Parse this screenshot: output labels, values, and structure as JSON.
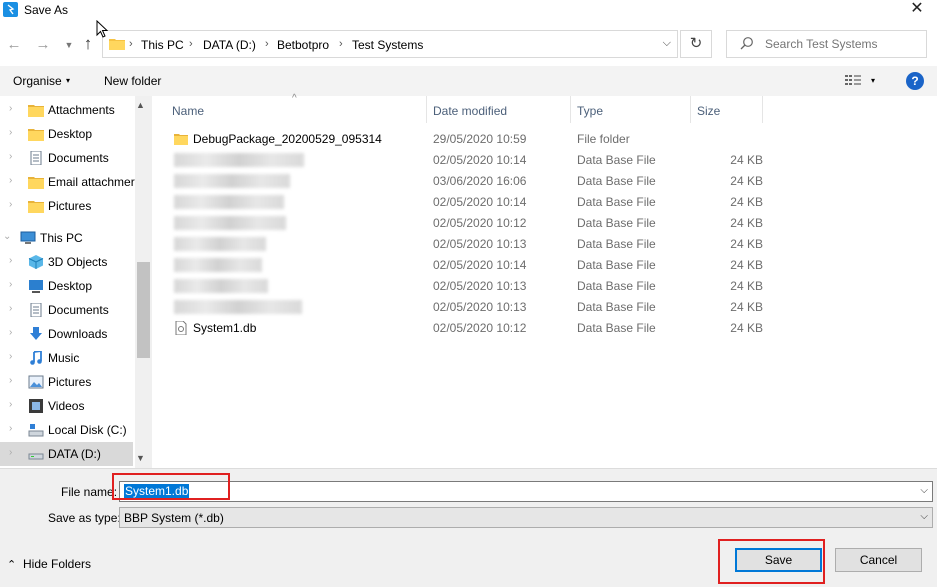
{
  "window": {
    "title": "Save As",
    "close_glyph": "✕"
  },
  "nav": {
    "back_glyph": "←",
    "forward_glyph": "→",
    "recent_glyph": "⌄",
    "up_glyph": "↑",
    "breadcrumbs": [
      "This PC",
      "DATA (D:)",
      "Betbotpro",
      "Test Systems"
    ],
    "separator": "›",
    "refresh_glyph": "↻",
    "search_placeholder": "Search Test Systems"
  },
  "toolbar": {
    "organise": "Organise",
    "new_folder": "New folder",
    "caret": "▾",
    "help": "?"
  },
  "sidebar": {
    "items": [
      {
        "label": "Attachments",
        "icon": "folder-icon"
      },
      {
        "label": "Desktop",
        "icon": "folder-icon"
      },
      {
        "label": "Documents",
        "icon": "documents-icon"
      },
      {
        "label": "Email attachmer",
        "icon": "folder-icon"
      },
      {
        "label": "Pictures",
        "icon": "folder-icon"
      },
      {
        "label": "This PC",
        "icon": "pc-icon"
      },
      {
        "label": "3D Objects",
        "icon": "cube-icon"
      },
      {
        "label": "Desktop",
        "icon": "desktop-icon"
      },
      {
        "label": "Documents",
        "icon": "documents-icon"
      },
      {
        "label": "Downloads",
        "icon": "download-icon"
      },
      {
        "label": "Music",
        "icon": "music-icon"
      },
      {
        "label": "Pictures",
        "icon": "pictures-icon"
      },
      {
        "label": "Videos",
        "icon": "videos-icon"
      },
      {
        "label": "Local Disk (C:)",
        "icon": "disk-icon"
      },
      {
        "label": "DATA (D:)",
        "icon": "drive-icon"
      }
    ]
  },
  "columns": {
    "name": "Name",
    "date": "Date modified",
    "type": "Type",
    "size": "Size"
  },
  "files": [
    {
      "name": "DebugPackage_20200529_095314",
      "date": "29/05/2020 10:59",
      "type": "File folder",
      "size": ""
    },
    {
      "name": "",
      "date": "02/05/2020 10:14",
      "type": "Data Base File",
      "size": "24 KB"
    },
    {
      "name": "",
      "date": "03/06/2020 16:06",
      "type": "Data Base File",
      "size": "24 KB"
    },
    {
      "name": "",
      "date": "02/05/2020 10:14",
      "type": "Data Base File",
      "size": "24 KB"
    },
    {
      "name": "",
      "date": "02/05/2020 10:12",
      "type": "Data Base File",
      "size": "24 KB"
    },
    {
      "name": "",
      "date": "02/05/2020 10:13",
      "type": "Data Base File",
      "size": "24 KB"
    },
    {
      "name": "",
      "date": "02/05/2020 10:14",
      "type": "Data Base File",
      "size": "24 KB"
    },
    {
      "name": "",
      "date": "02/05/2020 10:13",
      "type": "Data Base File",
      "size": "24 KB"
    },
    {
      "name": "",
      "date": "02/05/2020 10:13",
      "type": "Data Base File",
      "size": "24 KB"
    },
    {
      "name": "System1.db",
      "date": "02/05/2020 10:12",
      "type": "Data Base File",
      "size": "24 KB"
    }
  ],
  "form": {
    "file_name_label": "File name:",
    "file_name_value": "System1.db",
    "save_type_label": "Save as type:",
    "save_type_value": "BBP System (*.db)",
    "dropdown_glyph": "⌵"
  },
  "footer": {
    "hide_folders": "Hide Folders",
    "hide_caret": "⌃",
    "save": "Save",
    "cancel": "Cancel"
  }
}
